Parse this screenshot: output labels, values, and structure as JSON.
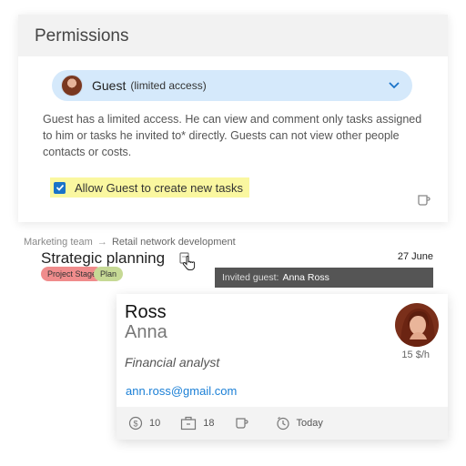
{
  "permissions": {
    "title": "Permissions",
    "role": {
      "name": "Guest",
      "access": "(limited access)"
    },
    "description": "Guest has a limited access. He can view and comment only tasks assigned to him or tasks he invited to* directly. Guests can not view other people contacts or costs.",
    "allow_create": {
      "label": "Allow Guest to create new tasks",
      "checked": true
    }
  },
  "task": {
    "breadcrumb": {
      "project": "Marketing team",
      "arrow": "→",
      "subproject": "Retail network development"
    },
    "title": "Strategic planning",
    "date": "27 June",
    "tags": [
      {
        "label": "Project Stage",
        "color": "#f08c8c"
      },
      {
        "label": "Plan",
        "color": "#c6d995"
      }
    ]
  },
  "tooltip": {
    "prefix": "Invited guest:",
    "name": "Anna Ross"
  },
  "contact": {
    "last_name": "Ross",
    "first_name": "Anna",
    "rate": "15 $/h",
    "role": "Financial analyst",
    "email": "ann.ross@gmail.com",
    "stats": {
      "cost": "10",
      "tasks": "18",
      "due": "Today"
    }
  },
  "colors": {
    "accent": "#1a73c8",
    "select_bg": "#d5e9fb",
    "highlight": "#faf7a0",
    "link": "#1a7fd6"
  }
}
